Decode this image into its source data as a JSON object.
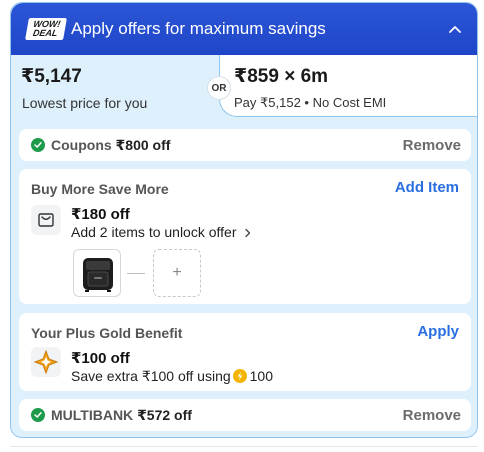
{
  "header": {
    "badge_line1": "WOW!",
    "badge_line2": "DEAL",
    "title": "Apply offers for maximum savings",
    "collapse_icon": "chevron-up-icon"
  },
  "pricing": {
    "lowest_price": "₹5,147",
    "lowest_label": "Lowest price for you",
    "or_label": "OR",
    "emi_price": "₹859 × 6m",
    "emi_label": "Pay ₹5,152 • No Cost EMI"
  },
  "coupons": {
    "label": "Coupons",
    "amount": "₹800 off",
    "action": "Remove"
  },
  "buy_more": {
    "title": "Buy More Save More",
    "action": "Add Item",
    "amount": "₹180 off",
    "subtitle": "Add 2 items to unlock offer",
    "add_symbol": "+"
  },
  "plus_gold": {
    "title": "Your Plus Gold Benefit",
    "action": "Apply",
    "amount": "₹100 off",
    "subtitle": "Save extra ₹100 off using",
    "coins": "100"
  },
  "multibank": {
    "label": "MULTIBANK",
    "amount": "₹572 off",
    "action": "Remove"
  },
  "colors": {
    "header_blue": "#1f46c8",
    "panel_blue": "#dff0fd",
    "link_blue": "#2a6fe0",
    "success_green": "#1e9a4b",
    "coin_gold": "#f5b400"
  }
}
